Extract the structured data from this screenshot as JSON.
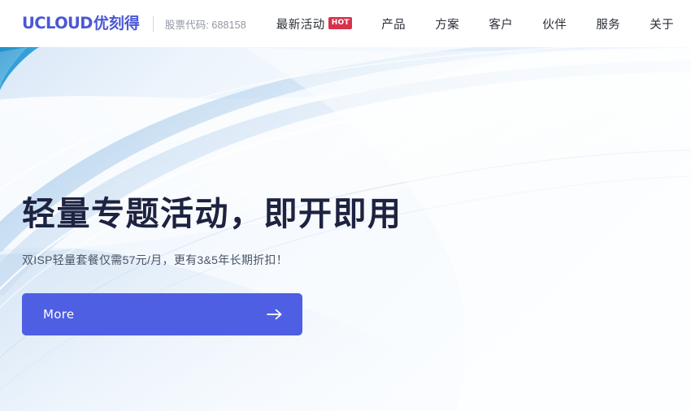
{
  "header": {
    "logo": {
      "english": "UCLOUD",
      "chinese": "优刻得",
      "color": "#4a57d6"
    },
    "stock_code": "股票代码: 688158",
    "nav": [
      {
        "label": "最新活动",
        "badge": "HOT",
        "badge_color": "#d8314c"
      },
      {
        "label": "产品",
        "badge": ""
      },
      {
        "label": "方案",
        "badge": ""
      },
      {
        "label": "客户",
        "badge": ""
      },
      {
        "label": "伙伴",
        "badge": ""
      },
      {
        "label": "服务",
        "badge": ""
      },
      {
        "label": "关于",
        "badge": ""
      }
    ]
  },
  "hero": {
    "headline": "轻量专题活动，即开即用",
    "headline_color": "#1d2340",
    "subheadline": "双ISP轻量套餐仅需57元/月，更有3&5年长期折扣！",
    "subheadline_color": "#4c5465",
    "cta": {
      "label": "More",
      "icon": "arrow-right-icon",
      "background_color": "#4f5fe3",
      "text_color": "#ffffff"
    },
    "background_colors": {
      "base_light": "#fafdff",
      "tint_blue": "#dce8f7",
      "ribbon_blue": "#9fc2e6",
      "accent_teal": "#2e9fd4"
    }
  }
}
